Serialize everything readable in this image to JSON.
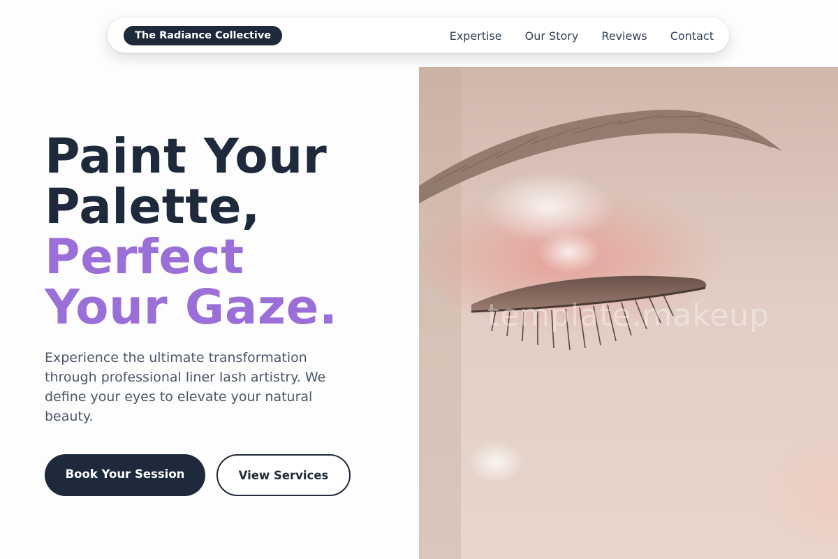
{
  "nav": {
    "brand": "The Radiance Collective",
    "links": [
      "Expertise",
      "Our Story",
      "Reviews",
      "Contact"
    ]
  },
  "hero": {
    "headline_line1": "Paint Your",
    "headline_line2": "Palette,",
    "headline_line3": "Perfect",
    "headline_line4": "Your Gaze.",
    "description": "Experience the ultimate transformation through professional liner lash artistry. We define your eyes to elevate your natural beauty.",
    "primary_button": "Book Your Session",
    "secondary_button": "View Services",
    "image_watermark": "template.makeup"
  },
  "colors": {
    "primary": "#1e293b",
    "accent": "#9a6fd8",
    "body_text": "#4b5768",
    "background": "#fdfdfd"
  },
  "icons": []
}
